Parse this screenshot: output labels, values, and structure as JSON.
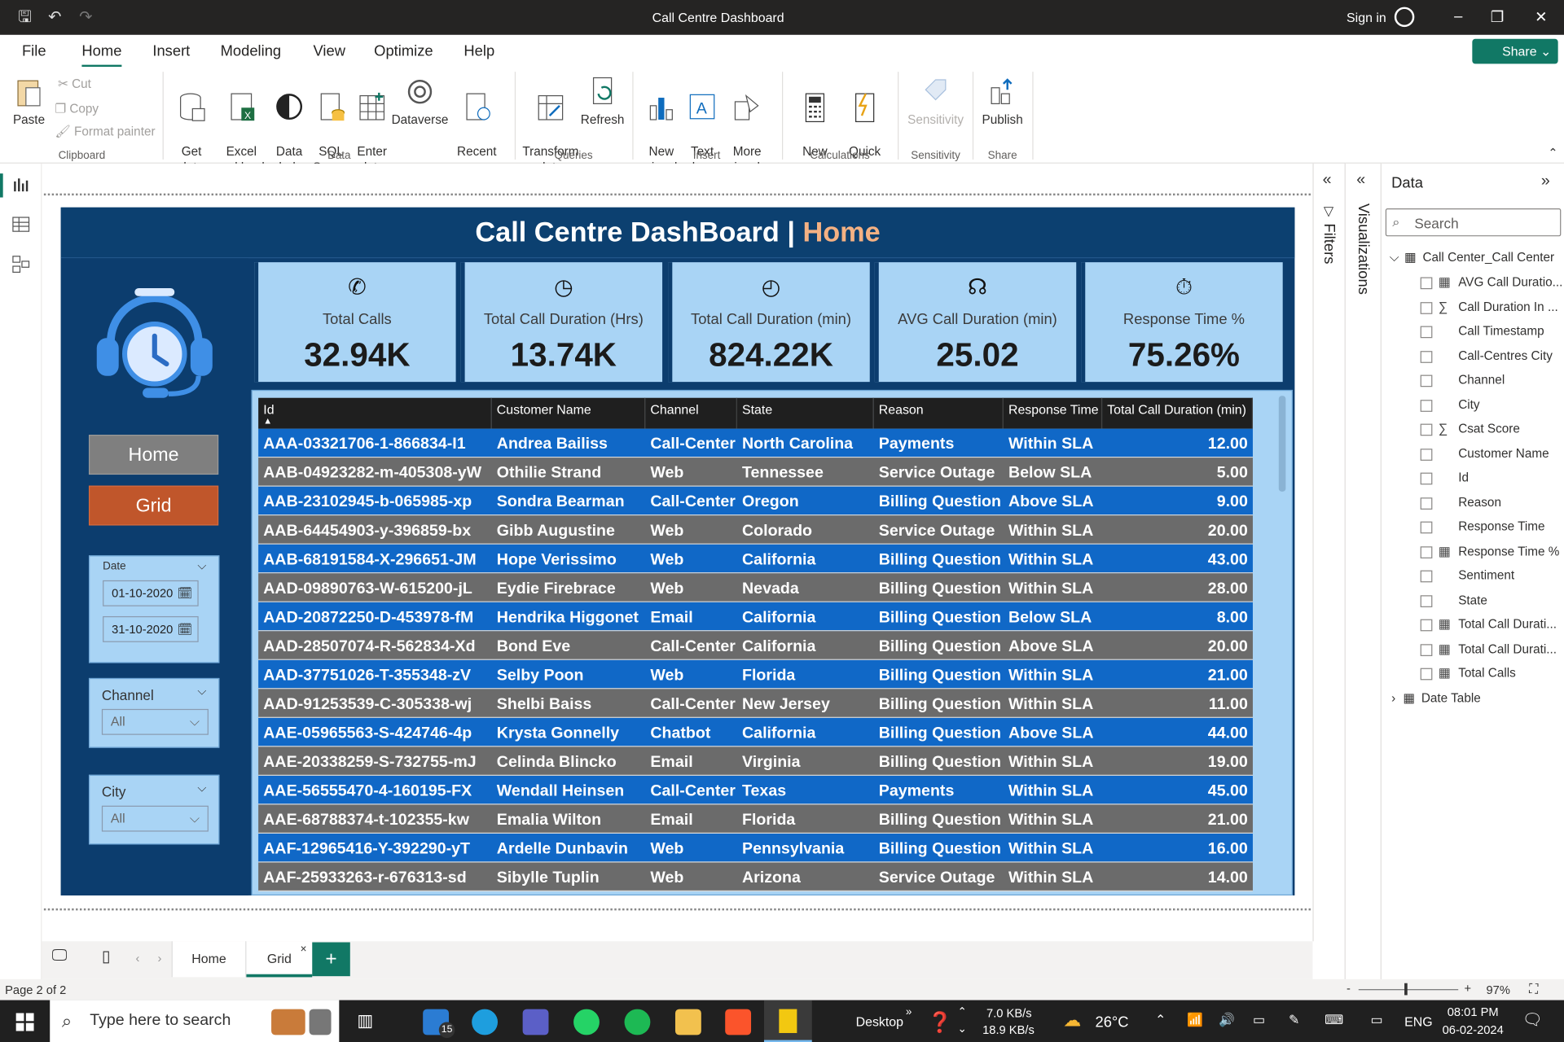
{
  "window": {
    "title": "Call Centre Dashboard",
    "signin": "Sign in"
  },
  "menu": {
    "items": [
      "File",
      "Home",
      "Insert",
      "Modeling",
      "View",
      "Optimize",
      "Help"
    ],
    "share": "Share"
  },
  "ribbon": {
    "paste": "Paste",
    "cut": "Cut",
    "copy": "Copy",
    "format_painter": "Format painter",
    "get_data": "Get\ndata",
    "excel": "Excel\nworkbook",
    "data_hub": "Data\nhub",
    "sql": "SQL\nServer",
    "enter_data": "Enter\ndata",
    "dataverse": "Dataverse",
    "recent": "Recent\nsources",
    "transform": "Transform\ndata",
    "refresh": "Refresh",
    "new_visual": "New\nvisual",
    "text_box": "Text\nbox",
    "more_visuals": "More\nvisuals",
    "new_measure": "New\nmeasure",
    "quick_measure": "Quick\nmeasure",
    "sensitivity": "Sensitivity",
    "publish": "Publish",
    "groups": {
      "clipboard": "Clipboard",
      "data": "Data",
      "queries": "Queries",
      "insert": "Insert",
      "calculations": "Calculations",
      "sensitivity": "Sensitivity",
      "share": "Share"
    }
  },
  "report": {
    "title_main": "Call Centre DashBoard | ",
    "title_highlight": "Home",
    "nav": {
      "home": "Home",
      "grid": "Grid"
    },
    "kpis": [
      {
        "label": "Total Calls",
        "value": "32.94K",
        "icon": "phone-icon"
      },
      {
        "label": "Total Call Duration (Hrs)",
        "value": "13.74K",
        "icon": "24h-clock-icon"
      },
      {
        "label": "Total Call Duration (min)",
        "value": "824.22K",
        "icon": "60min-timer-icon"
      },
      {
        "label": "AVG Call Duration (min)",
        "value": "25.02",
        "icon": "headset-icon"
      },
      {
        "label": "Response Time %",
        "value": "75.26%",
        "icon": "stopwatch-icon"
      }
    ],
    "slicers": {
      "date": {
        "title": "Date",
        "from": "01-10-2020",
        "to": "31-10-2020"
      },
      "channel": {
        "title": "Channel",
        "value": "All"
      },
      "city": {
        "title": "City",
        "value": "All"
      }
    },
    "table": {
      "columns": [
        "Id",
        "Customer Name",
        "Channel",
        "State",
        "Reason",
        "Response Time",
        "Total Call Duration (min)"
      ],
      "rows": [
        [
          "AAA-03321706-1-866834-I1",
          "Andrea Bailiss",
          "Call-Center",
          "North Carolina",
          "Payments",
          "Within SLA",
          "12.00"
        ],
        [
          "AAB-04923282-m-405308-yW",
          "Othilie Strand",
          "Web",
          "Tennessee",
          "Service Outage",
          "Below SLA",
          "5.00"
        ],
        [
          "AAB-23102945-b-065985-xp",
          "Sondra Bearman",
          "Call-Center",
          "Oregon",
          "Billing Question",
          "Above SLA",
          "9.00"
        ],
        [
          "AAB-64454903-y-396859-bx",
          "Gibb Augustine",
          "Web",
          "Colorado",
          "Service Outage",
          "Within SLA",
          "20.00"
        ],
        [
          "AAB-68191584-X-296651-JM",
          "Hope Verissimo",
          "Web",
          "California",
          "Billing Question",
          "Within SLA",
          "43.00"
        ],
        [
          "AAD-09890763-W-615200-jL",
          "Eydie Firebrace",
          "Web",
          "Nevada",
          "Billing Question",
          "Within SLA",
          "28.00"
        ],
        [
          "AAD-20872250-D-453978-fM",
          "Hendrika Higgonet",
          "Email",
          "California",
          "Billing Question",
          "Below SLA",
          "8.00"
        ],
        [
          "AAD-28507074-R-562834-Xd",
          "Bond Eve",
          "Call-Center",
          "California",
          "Billing Question",
          "Above SLA",
          "20.00"
        ],
        [
          "AAD-37751026-T-355348-zV",
          "Selby Poon",
          "Web",
          "Florida",
          "Billing Question",
          "Within SLA",
          "21.00"
        ],
        [
          "AAD-91253539-C-305338-wj",
          "Shelbi Baiss",
          "Call-Center",
          "New Jersey",
          "Billing Question",
          "Within SLA",
          "11.00"
        ],
        [
          "AAE-05965563-S-424746-4p",
          "Krysta Gonnelly",
          "Chatbot",
          "California",
          "Billing Question",
          "Above SLA",
          "44.00"
        ],
        [
          "AAE-20338259-S-732755-mJ",
          "Celinda Blincko",
          "Email",
          "Virginia",
          "Billing Question",
          "Within SLA",
          "19.00"
        ],
        [
          "AAE-56555470-4-160195-FX",
          "Wendall Heinsen",
          "Call-Center",
          "Texas",
          "Payments",
          "Within SLA",
          "45.00"
        ],
        [
          "AAE-68788374-t-102355-kw",
          "Emalia Wilton",
          "Email",
          "Florida",
          "Billing Question",
          "Within SLA",
          "21.00"
        ],
        [
          "AAF-12965416-Y-392290-yT",
          "Ardelle Dunbavin",
          "Web",
          "Pennsylvania",
          "Billing Question",
          "Within SLA",
          "16.00"
        ],
        [
          "AAF-25933263-r-676313-sd",
          "Sibylle Tuplin",
          "Web",
          "Arizona",
          "Service Outage",
          "Within SLA",
          "14.00"
        ]
      ]
    }
  },
  "panes": {
    "filters": "Filters",
    "visualizations": "Visualizations",
    "data_title": "Data",
    "search_placeholder": "Search",
    "table_name": "Call Center_Call Center",
    "fields": [
      {
        "name": "AVG Call Duratio...",
        "icon": "calc"
      },
      {
        "name": "Call Duration In ...",
        "icon": "sum"
      },
      {
        "name": "Call Timestamp",
        "icon": ""
      },
      {
        "name": "Call-Centres City",
        "icon": ""
      },
      {
        "name": "Channel",
        "icon": ""
      },
      {
        "name": "City",
        "icon": ""
      },
      {
        "name": "Csat Score",
        "icon": "sum"
      },
      {
        "name": "Customer Name",
        "icon": ""
      },
      {
        "name": "Id",
        "icon": ""
      },
      {
        "name": "Reason",
        "icon": ""
      },
      {
        "name": "Response Time",
        "icon": ""
      },
      {
        "name": "Response Time %",
        "icon": "calc"
      },
      {
        "name": "Sentiment",
        "icon": ""
      },
      {
        "name": "State",
        "icon": ""
      },
      {
        "name": "Total Call Durati...",
        "icon": "calc"
      },
      {
        "name": "Total Call Durati...",
        "icon": "calc"
      },
      {
        "name": "Total Calls",
        "icon": "calc"
      }
    ],
    "date_table": "Date Table"
  },
  "pages": {
    "tabs": [
      "Home",
      "Grid"
    ],
    "active": "Grid",
    "status": "Page 2 of 2",
    "zoom": "97%"
  },
  "taskbar": {
    "search": "Type here to search",
    "desktop": "Desktop",
    "net_up": "7.0 KB/s",
    "net_down": "18.9 KB/s",
    "temp": "26°C",
    "lang": "ENG",
    "time": "08:01 PM",
    "date": "06-02-2024",
    "mail_badge": "15"
  },
  "colors": {
    "report_bg": "#0c3d6e",
    "kpi_bg": "#a9d4f5",
    "row_blue": "#1068c7",
    "row_gray": "#6b6b6b",
    "home_btn": "#7f7f7f",
    "grid_btn": "#c0562b",
    "accent": "#117865",
    "title_highlight": "#f4b183"
  }
}
